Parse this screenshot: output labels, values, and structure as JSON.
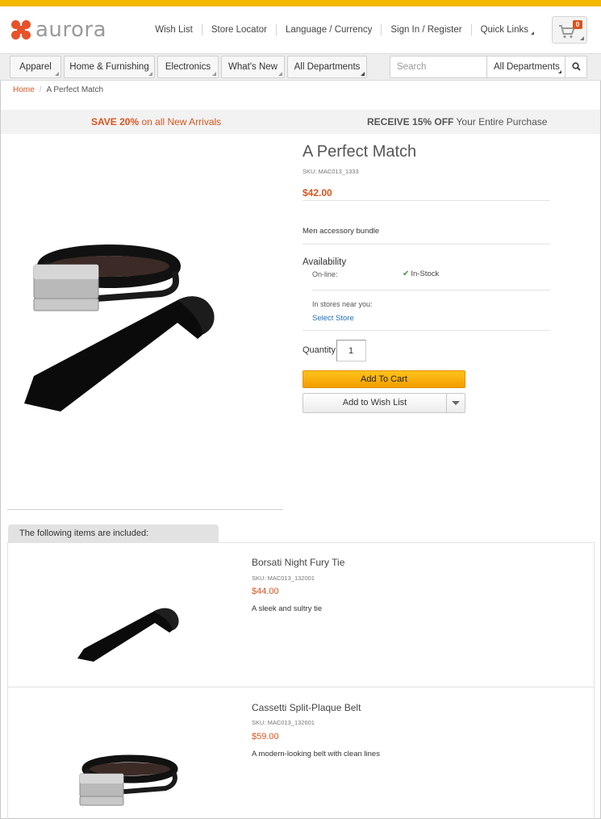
{
  "brand": {
    "name": "aurora",
    "accent": "#f5b800",
    "price_color": "#d9541e",
    "link_color": "#1f6fbd"
  },
  "header": {
    "links": [
      "Wish List",
      "Store Locator",
      "Language / Currency",
      "Sign In / Register",
      "Quick Links"
    ],
    "cart_count": "0",
    "cart_icon": "shopping-cart-icon"
  },
  "nav": {
    "items": [
      "Apparel",
      "Home & Furnishing",
      "Electronics",
      "What's New",
      "All Departments"
    ],
    "search_placeholder": "Search",
    "search_department": "All Departments",
    "search_icon": "magnifier-icon"
  },
  "breadcrumb": {
    "home": "Home",
    "current": "A Perfect Match"
  },
  "promo": {
    "left_bold": "SAVE 20%",
    "left_rest": "on all New Arrivals",
    "right_bold": "RECEIVE 15% OFF",
    "right_rest": "Your Entire Purchase"
  },
  "product": {
    "name": "A Perfect Match",
    "sku": "SKU: MAC013_1333",
    "price": "$42.00",
    "description": "Men accessory bundle",
    "availability_label": "Availability",
    "online_label": "On-line:",
    "online_status": "In-Stock",
    "stores_label": "In stores near you:",
    "select_store": "Select Store",
    "quantity_label": "Quantity",
    "quantity": "1",
    "add_to_cart": "Add To Cart",
    "add_to_wishlist": "Add to Wish List"
  },
  "included": {
    "title": "The following items are included:",
    "items": [
      {
        "name": "Borsati Night Fury Tie",
        "sku": "SKU: MAC013_132001",
        "price": "$44.00",
        "description": "A sleek and sultry tie"
      },
      {
        "name": "Cassetti Split-Plaque Belt",
        "sku": "SKU: MAC013_132601",
        "price": "$59.00",
        "description": "A modern-looking belt with clean lines"
      }
    ]
  }
}
